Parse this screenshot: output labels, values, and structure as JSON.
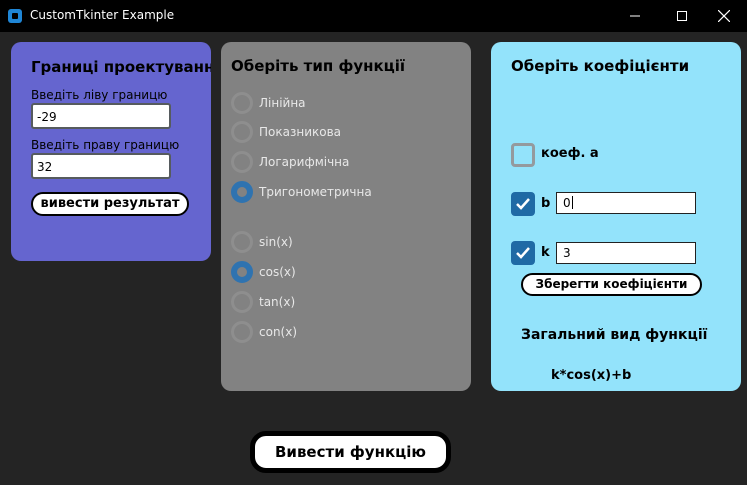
{
  "window": {
    "title": "CustomTkinter Example",
    "controls": {
      "minimize": "minimize-icon",
      "maximize": "maximize-icon",
      "close": "close-icon"
    }
  },
  "bounds_panel": {
    "title": "Границі проектування",
    "left_label": "Введіть ліву границю",
    "left_value": "-29",
    "right_label": "Введіть праву границю",
    "right_value": "32",
    "button": "вивести результат"
  },
  "type_panel": {
    "title": "Оберіть тип функції",
    "types": [
      {
        "label": "Лінійна",
        "selected": false
      },
      {
        "label": "Показникова",
        "selected": false
      },
      {
        "label": "Логарифмічна",
        "selected": false
      },
      {
        "label": "Тригонометрична",
        "selected": true
      }
    ],
    "trig": [
      {
        "label": "sin(x)",
        "selected": false
      },
      {
        "label": "cos(x)",
        "selected": true
      },
      {
        "label": "tan(x)",
        "selected": false
      },
      {
        "label": "con(x)",
        "selected": false
      }
    ]
  },
  "coef_panel": {
    "title": "Оберіть коефіцієнти",
    "a": {
      "label": "коеф. а",
      "checked": false
    },
    "b": {
      "label": "b",
      "checked": true,
      "value": "0"
    },
    "k": {
      "label": "k",
      "checked": true,
      "value": "3"
    },
    "save_button": "Зберегти коефіцієнти",
    "general_title": "Загальний вид функції",
    "formula": "k*cos(x)+b"
  },
  "main_button": "Вивести функцію",
  "colors": {
    "bounds_panel_bg": "#6565cf",
    "type_panel_bg": "#828282",
    "coef_panel_bg": "#93e3fb",
    "accent": "#1f6aa5",
    "window_bg": "#242424"
  }
}
